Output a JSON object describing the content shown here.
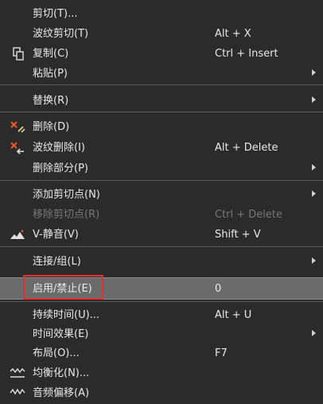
{
  "menu": {
    "items": [
      {
        "label": "剪切(T)..."
      },
      {
        "label": "波纹剪切(T)",
        "shortcut": "Alt + X"
      },
      {
        "label": "复制(C)",
        "shortcut": "Ctrl + Insert",
        "icon": "copy-icon"
      },
      {
        "label": "粘贴(P)",
        "submenu": true
      },
      {
        "label": "替换(R)",
        "submenu": true
      },
      {
        "label": "删除(D)",
        "icon": "delete-icon"
      },
      {
        "label": "波纹删除(I)",
        "shortcut": "Alt + Delete",
        "icon": "ripple-delete-icon"
      },
      {
        "label": "删除部分(P)",
        "submenu": true
      },
      {
        "label": "添加剪切点(N)",
        "submenu": true
      },
      {
        "label": "移除剪切点(R)",
        "shortcut": "Ctrl + Delete",
        "disabled": true
      },
      {
        "label": "V-静音(V)",
        "shortcut": "Shift + V",
        "icon": "v-mute-icon"
      },
      {
        "label": "连接/组(L)",
        "submenu": true
      },
      {
        "label": "启用/禁止(E)",
        "shortcut": "0",
        "selected": true
      },
      {
        "label": "持续时间(U)...",
        "shortcut": "Alt + U"
      },
      {
        "label": "时间效果(E)",
        "submenu": true
      },
      {
        "label": "布局(O)...",
        "shortcut": "F7"
      },
      {
        "label": "均衡化(N)...",
        "icon": "equalize-icon"
      },
      {
        "label": "音频偏移(A)",
        "icon": "audio-offset-icon"
      }
    ]
  },
  "colors": {
    "background": "#2b2b2b",
    "selected": "#6b6b6b",
    "highlight_box": "#e53030",
    "disabled_text": "#777777"
  }
}
